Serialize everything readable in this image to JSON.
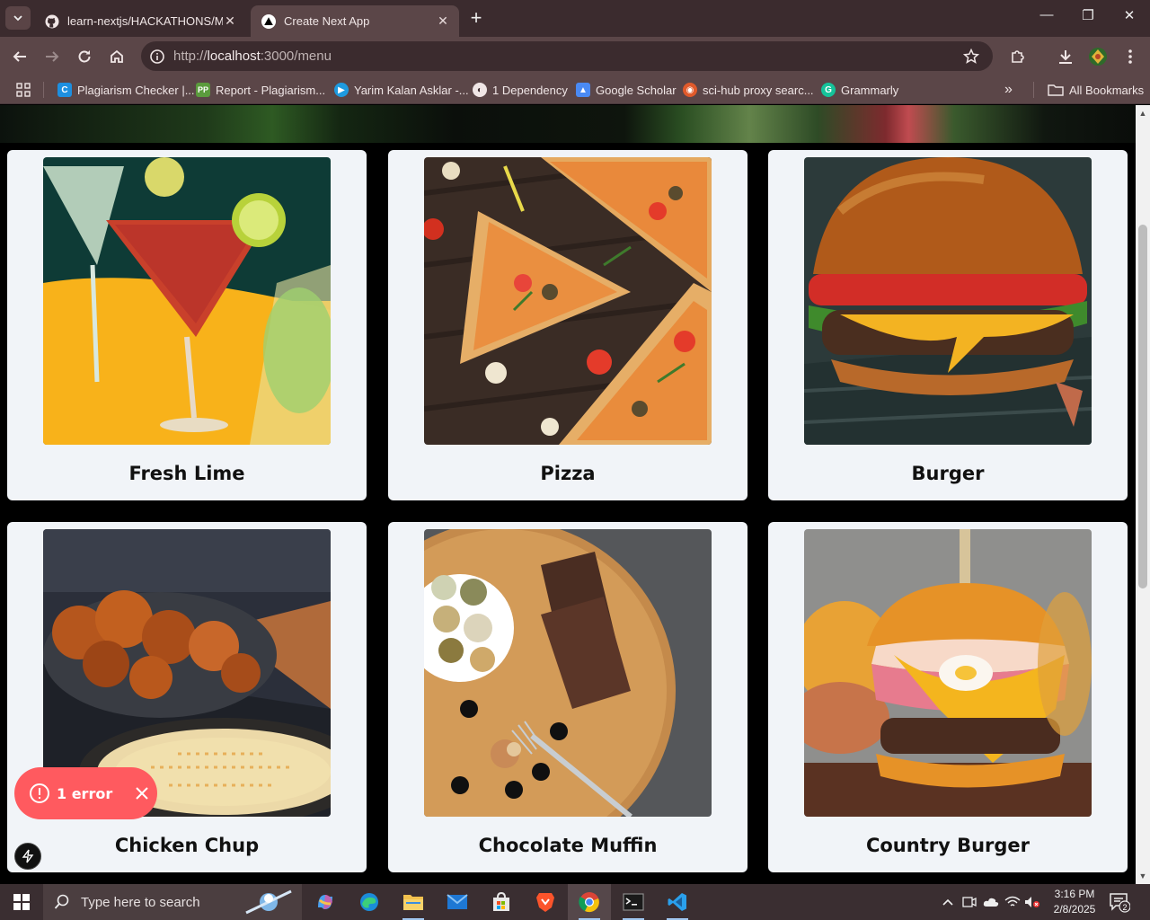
{
  "browser": {
    "tabs": [
      {
        "title": "learn-nextjs/HACKATHONS/Ma",
        "active": false,
        "icon": "github-icon"
      },
      {
        "title": "Create Next App",
        "active": true,
        "icon": "nextjs-icon"
      }
    ],
    "new_tab_symbol": "+",
    "window_controls": {
      "minimize": "—",
      "restore": "❐",
      "close": "✕"
    },
    "address": {
      "prefix": "http://",
      "host": "localhost",
      "rest": ":3000/menu"
    },
    "bookmarks": [
      {
        "label": "Plagiarism Checker |...",
        "icon": "plagiarism-checker-icon",
        "color": "#1d8fe0"
      },
      {
        "label": "Report - Plagiarism...",
        "icon": "pp-icon",
        "color": "#5b9b3d"
      },
      {
        "label": "Yarim Kalan Asklar -...",
        "icon": "play-icon",
        "color": "#1e9be0"
      },
      {
        "label": "1 Dependency",
        "icon": "globe-icon",
        "color": "#ffffff"
      },
      {
        "label": "Google Scholar",
        "icon": "scholar-icon",
        "color": "#4a8af4"
      },
      {
        "label": "sci-hub proxy searc...",
        "icon": "scihub-icon",
        "color": "#e05a2b"
      },
      {
        "label": "Grammarly",
        "icon": "grammarly-icon",
        "color": "#15c39a"
      }
    ],
    "more_bookmarks": "»",
    "all_bookmarks": "All Bookmarks"
  },
  "menu": {
    "items": [
      {
        "name": "Fresh Lime",
        "image": "fresh-lime-cocktails-image"
      },
      {
        "name": "Pizza",
        "image": "pizza-image"
      },
      {
        "name": "Burger",
        "image": "burger-image"
      },
      {
        "name": "Chicken Chup",
        "image": "chicken-chup-image"
      },
      {
        "name": "Chocolate Muffin",
        "image": "chocolate-muffin-image"
      },
      {
        "name": "Country Burger",
        "image": "country-burger-image"
      }
    ]
  },
  "dev_overlay": {
    "error_label": "1 error"
  },
  "taskbar": {
    "search_placeholder": "Type here to search",
    "time": "3:16 PM",
    "date": "2/8/2025",
    "notification_count": "2"
  },
  "colors": {
    "tab_bar": "#3b2b2e",
    "toolbar": "#5b4648",
    "card_bg": "#f1f4f8",
    "error_pill": "#ff5a5f",
    "taskbar": "#3a2e31"
  }
}
